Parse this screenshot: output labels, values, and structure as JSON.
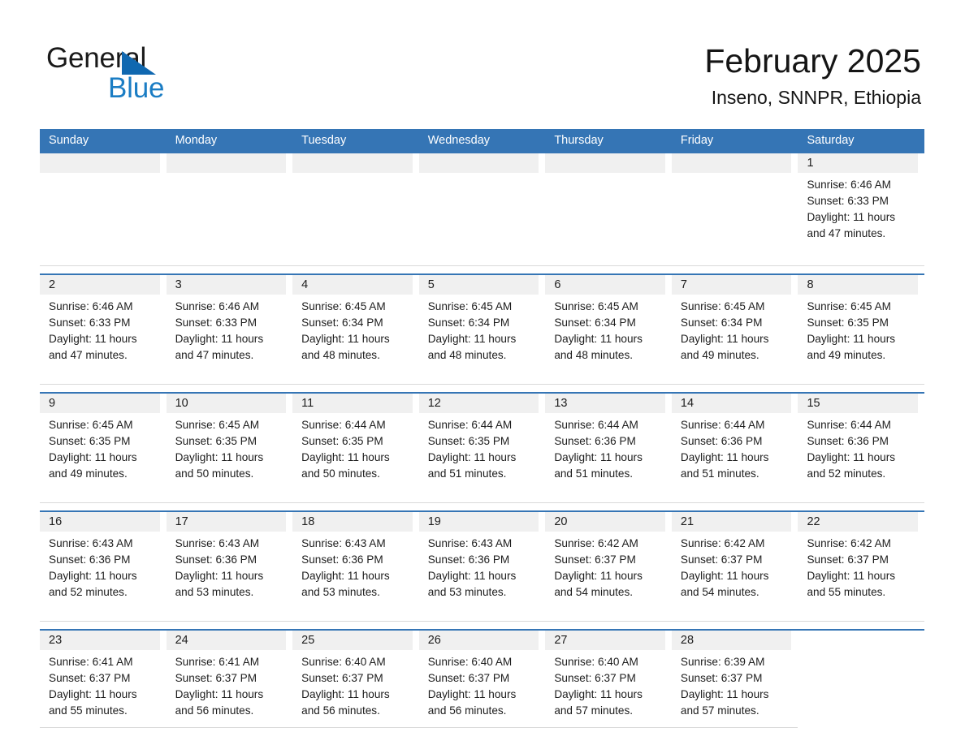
{
  "brand": {
    "name_part1": "General",
    "name_part2": "Blue",
    "triangle_color": "#1068b0",
    "blue_color": "#1b7dc4"
  },
  "header": {
    "title": "February 2025",
    "subtitle": "Inseno, SNNPR, Ethiopia",
    "accent_color": "#3575b5",
    "band_color": "#f0f0f0"
  },
  "weekdays": [
    "Sunday",
    "Monday",
    "Tuesday",
    "Wednesday",
    "Thursday",
    "Friday",
    "Saturday"
  ],
  "weeks": [
    {
      "days": [
        {
          "date": "",
          "empty": true
        },
        {
          "date": "",
          "empty": true
        },
        {
          "date": "",
          "empty": true
        },
        {
          "date": "",
          "empty": true
        },
        {
          "date": "",
          "empty": true
        },
        {
          "date": "",
          "empty": true
        },
        {
          "date": "1",
          "sunrise": "Sunrise: 6:46 AM",
          "sunset": "Sunset: 6:33 PM",
          "daylight_1": "Daylight: 11 hours",
          "daylight_2": "and 47 minutes."
        }
      ]
    },
    {
      "days": [
        {
          "date": "2",
          "sunrise": "Sunrise: 6:46 AM",
          "sunset": "Sunset: 6:33 PM",
          "daylight_1": "Daylight: 11 hours",
          "daylight_2": "and 47 minutes."
        },
        {
          "date": "3",
          "sunrise": "Sunrise: 6:46 AM",
          "sunset": "Sunset: 6:33 PM",
          "daylight_1": "Daylight: 11 hours",
          "daylight_2": "and 47 minutes."
        },
        {
          "date": "4",
          "sunrise": "Sunrise: 6:45 AM",
          "sunset": "Sunset: 6:34 PM",
          "daylight_1": "Daylight: 11 hours",
          "daylight_2": "and 48 minutes."
        },
        {
          "date": "5",
          "sunrise": "Sunrise: 6:45 AM",
          "sunset": "Sunset: 6:34 PM",
          "daylight_1": "Daylight: 11 hours",
          "daylight_2": "and 48 minutes."
        },
        {
          "date": "6",
          "sunrise": "Sunrise: 6:45 AM",
          "sunset": "Sunset: 6:34 PM",
          "daylight_1": "Daylight: 11 hours",
          "daylight_2": "and 48 minutes."
        },
        {
          "date": "7",
          "sunrise": "Sunrise: 6:45 AM",
          "sunset": "Sunset: 6:34 PM",
          "daylight_1": "Daylight: 11 hours",
          "daylight_2": "and 49 minutes."
        },
        {
          "date": "8",
          "sunrise": "Sunrise: 6:45 AM",
          "sunset": "Sunset: 6:35 PM",
          "daylight_1": "Daylight: 11 hours",
          "daylight_2": "and 49 minutes."
        }
      ]
    },
    {
      "days": [
        {
          "date": "9",
          "sunrise": "Sunrise: 6:45 AM",
          "sunset": "Sunset: 6:35 PM",
          "daylight_1": "Daylight: 11 hours",
          "daylight_2": "and 49 minutes."
        },
        {
          "date": "10",
          "sunrise": "Sunrise: 6:45 AM",
          "sunset": "Sunset: 6:35 PM",
          "daylight_1": "Daylight: 11 hours",
          "daylight_2": "and 50 minutes."
        },
        {
          "date": "11",
          "sunrise": "Sunrise: 6:44 AM",
          "sunset": "Sunset: 6:35 PM",
          "daylight_1": "Daylight: 11 hours",
          "daylight_2": "and 50 minutes."
        },
        {
          "date": "12",
          "sunrise": "Sunrise: 6:44 AM",
          "sunset": "Sunset: 6:35 PM",
          "daylight_1": "Daylight: 11 hours",
          "daylight_2": "and 51 minutes."
        },
        {
          "date": "13",
          "sunrise": "Sunrise: 6:44 AM",
          "sunset": "Sunset: 6:36 PM",
          "daylight_1": "Daylight: 11 hours",
          "daylight_2": "and 51 minutes."
        },
        {
          "date": "14",
          "sunrise": "Sunrise: 6:44 AM",
          "sunset": "Sunset: 6:36 PM",
          "daylight_1": "Daylight: 11 hours",
          "daylight_2": "and 51 minutes."
        },
        {
          "date": "15",
          "sunrise": "Sunrise: 6:44 AM",
          "sunset": "Sunset: 6:36 PM",
          "daylight_1": "Daylight: 11 hours",
          "daylight_2": "and 52 minutes."
        }
      ]
    },
    {
      "days": [
        {
          "date": "16",
          "sunrise": "Sunrise: 6:43 AM",
          "sunset": "Sunset: 6:36 PM",
          "daylight_1": "Daylight: 11 hours",
          "daylight_2": "and 52 minutes."
        },
        {
          "date": "17",
          "sunrise": "Sunrise: 6:43 AM",
          "sunset": "Sunset: 6:36 PM",
          "daylight_1": "Daylight: 11 hours",
          "daylight_2": "and 53 minutes."
        },
        {
          "date": "18",
          "sunrise": "Sunrise: 6:43 AM",
          "sunset": "Sunset: 6:36 PM",
          "daylight_1": "Daylight: 11 hours",
          "daylight_2": "and 53 minutes."
        },
        {
          "date": "19",
          "sunrise": "Sunrise: 6:43 AM",
          "sunset": "Sunset: 6:36 PM",
          "daylight_1": "Daylight: 11 hours",
          "daylight_2": "and 53 minutes."
        },
        {
          "date": "20",
          "sunrise": "Sunrise: 6:42 AM",
          "sunset": "Sunset: 6:37 PM",
          "daylight_1": "Daylight: 11 hours",
          "daylight_2": "and 54 minutes."
        },
        {
          "date": "21",
          "sunrise": "Sunrise: 6:42 AM",
          "sunset": "Sunset: 6:37 PM",
          "daylight_1": "Daylight: 11 hours",
          "daylight_2": "and 54 minutes."
        },
        {
          "date": "22",
          "sunrise": "Sunrise: 6:42 AM",
          "sunset": "Sunset: 6:37 PM",
          "daylight_1": "Daylight: 11 hours",
          "daylight_2": "and 55 minutes."
        }
      ]
    },
    {
      "days": [
        {
          "date": "23",
          "sunrise": "Sunrise: 6:41 AM",
          "sunset": "Sunset: 6:37 PM",
          "daylight_1": "Daylight: 11 hours",
          "daylight_2": "and 55 minutes."
        },
        {
          "date": "24",
          "sunrise": "Sunrise: 6:41 AM",
          "sunset": "Sunset: 6:37 PM",
          "daylight_1": "Daylight: 11 hours",
          "daylight_2": "and 56 minutes."
        },
        {
          "date": "25",
          "sunrise": "Sunrise: 6:40 AM",
          "sunset": "Sunset: 6:37 PM",
          "daylight_1": "Daylight: 11 hours",
          "daylight_2": "and 56 minutes."
        },
        {
          "date": "26",
          "sunrise": "Sunrise: 6:40 AM",
          "sunset": "Sunset: 6:37 PM",
          "daylight_1": "Daylight: 11 hours",
          "daylight_2": "and 56 minutes."
        },
        {
          "date": "27",
          "sunrise": "Sunrise: 6:40 AM",
          "sunset": "Sunset: 6:37 PM",
          "daylight_1": "Daylight: 11 hours",
          "daylight_2": "and 57 minutes."
        },
        {
          "date": "28",
          "sunrise": "Sunrise: 6:39 AM",
          "sunset": "Sunset: 6:37 PM",
          "daylight_1": "Daylight: 11 hours",
          "daylight_2": "and 57 minutes."
        },
        {
          "date": "",
          "blank": true
        }
      ]
    }
  ]
}
